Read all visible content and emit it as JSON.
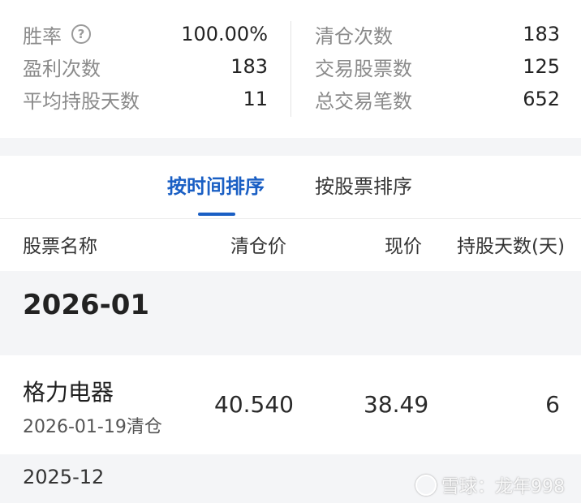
{
  "stats": {
    "left": [
      {
        "label": "胜率",
        "value": "100.00%",
        "has_help": true
      },
      {
        "label": "盈利次数",
        "value": "183"
      },
      {
        "label": "平均持股天数",
        "value": "11"
      }
    ],
    "right": [
      {
        "label": "清仓次数",
        "value": "183"
      },
      {
        "label": "交易股票数",
        "value": "125"
      },
      {
        "label": "总交易笔数",
        "value": "652"
      }
    ]
  },
  "tabs": [
    {
      "label": "按时间排序",
      "active": true
    },
    {
      "label": "按股票排序",
      "active": false
    }
  ],
  "columns": [
    "股票名称",
    "清仓价",
    "现价",
    "持股天数(天)"
  ],
  "groups": [
    {
      "month": "2026-01",
      "rows": [
        {
          "name": "格力电器",
          "sub": "2026-01-19清仓",
          "clear_price": "40.540",
          "current_price": "38.49",
          "days": "6"
        }
      ]
    },
    {
      "month": "2025-12",
      "rows": []
    }
  ],
  "watermark": "雪球：龙年998",
  "colors": {
    "accent": "#1a5fc4",
    "band": "#f4f5f7"
  }
}
